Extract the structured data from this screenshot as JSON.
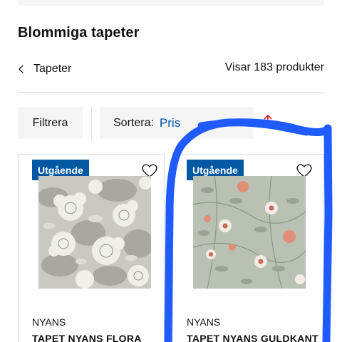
{
  "colors": {
    "accent": "#0058a3",
    "sort_arrow": "#cc0008",
    "annotation_stroke": "#1f5bff",
    "surface": "#f5f5f5"
  },
  "page": {
    "title": "Blommiga tapeter"
  },
  "breadcrumb": {
    "icon": "chevron-left-icon",
    "label": "Tapeter"
  },
  "results": {
    "count_text": "Visar 183 produkter"
  },
  "toolbar": {
    "filter_label": "Filtrera",
    "sort_label": "Sortera:",
    "sort_value": "Pris",
    "sort_direction_icon": "arrow-up-icon"
  },
  "products": [
    {
      "badge": "Utgående",
      "brand": "NYANS",
      "name": "TAPET NYANS FLORA",
      "favorite_icon": "heart-outline-icon",
      "image": "grey-white-floral-wallpaper"
    },
    {
      "badge": "Utgående",
      "brand": "NYANS",
      "name": "TAPET NYANS GULDKANT",
      "favorite_icon": "heart-outline-icon",
      "image": "sage-peach-floral-wallpaper"
    }
  ]
}
